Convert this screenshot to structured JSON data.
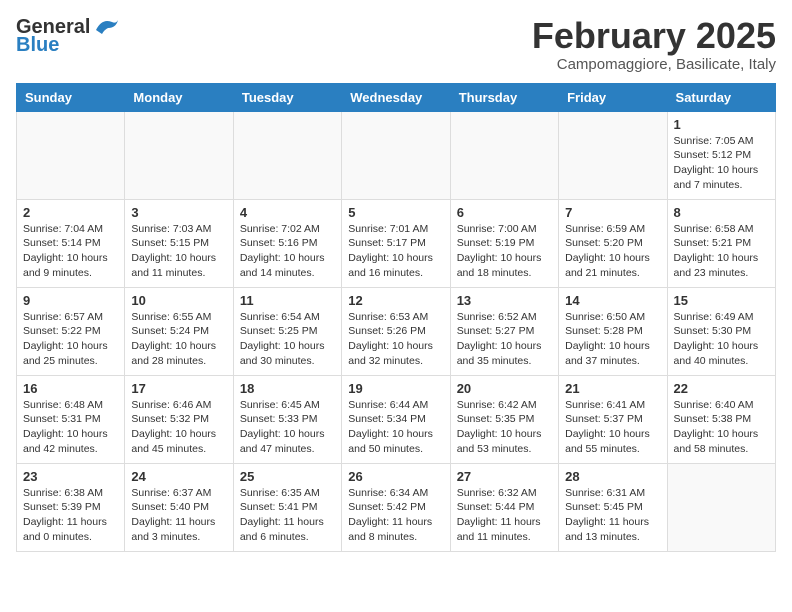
{
  "header": {
    "logo_general": "General",
    "logo_blue": "Blue",
    "title": "February 2025",
    "subtitle": "Campomaggiore, Basilicate, Italy"
  },
  "columns": [
    "Sunday",
    "Monday",
    "Tuesday",
    "Wednesday",
    "Thursday",
    "Friday",
    "Saturday"
  ],
  "weeks": [
    [
      {
        "day": "",
        "info": ""
      },
      {
        "day": "",
        "info": ""
      },
      {
        "day": "",
        "info": ""
      },
      {
        "day": "",
        "info": ""
      },
      {
        "day": "",
        "info": ""
      },
      {
        "day": "",
        "info": ""
      },
      {
        "day": "1",
        "info": "Sunrise: 7:05 AM\nSunset: 5:12 PM\nDaylight: 10 hours and 7 minutes."
      }
    ],
    [
      {
        "day": "2",
        "info": "Sunrise: 7:04 AM\nSunset: 5:14 PM\nDaylight: 10 hours and 9 minutes."
      },
      {
        "day": "3",
        "info": "Sunrise: 7:03 AM\nSunset: 5:15 PM\nDaylight: 10 hours and 11 minutes."
      },
      {
        "day": "4",
        "info": "Sunrise: 7:02 AM\nSunset: 5:16 PM\nDaylight: 10 hours and 14 minutes."
      },
      {
        "day": "5",
        "info": "Sunrise: 7:01 AM\nSunset: 5:17 PM\nDaylight: 10 hours and 16 minutes."
      },
      {
        "day": "6",
        "info": "Sunrise: 7:00 AM\nSunset: 5:19 PM\nDaylight: 10 hours and 18 minutes."
      },
      {
        "day": "7",
        "info": "Sunrise: 6:59 AM\nSunset: 5:20 PM\nDaylight: 10 hours and 21 minutes."
      },
      {
        "day": "8",
        "info": "Sunrise: 6:58 AM\nSunset: 5:21 PM\nDaylight: 10 hours and 23 minutes."
      }
    ],
    [
      {
        "day": "9",
        "info": "Sunrise: 6:57 AM\nSunset: 5:22 PM\nDaylight: 10 hours and 25 minutes."
      },
      {
        "day": "10",
        "info": "Sunrise: 6:55 AM\nSunset: 5:24 PM\nDaylight: 10 hours and 28 minutes."
      },
      {
        "day": "11",
        "info": "Sunrise: 6:54 AM\nSunset: 5:25 PM\nDaylight: 10 hours and 30 minutes."
      },
      {
        "day": "12",
        "info": "Sunrise: 6:53 AM\nSunset: 5:26 PM\nDaylight: 10 hours and 32 minutes."
      },
      {
        "day": "13",
        "info": "Sunrise: 6:52 AM\nSunset: 5:27 PM\nDaylight: 10 hours and 35 minutes."
      },
      {
        "day": "14",
        "info": "Sunrise: 6:50 AM\nSunset: 5:28 PM\nDaylight: 10 hours and 37 minutes."
      },
      {
        "day": "15",
        "info": "Sunrise: 6:49 AM\nSunset: 5:30 PM\nDaylight: 10 hours and 40 minutes."
      }
    ],
    [
      {
        "day": "16",
        "info": "Sunrise: 6:48 AM\nSunset: 5:31 PM\nDaylight: 10 hours and 42 minutes."
      },
      {
        "day": "17",
        "info": "Sunrise: 6:46 AM\nSunset: 5:32 PM\nDaylight: 10 hours and 45 minutes."
      },
      {
        "day": "18",
        "info": "Sunrise: 6:45 AM\nSunset: 5:33 PM\nDaylight: 10 hours and 47 minutes."
      },
      {
        "day": "19",
        "info": "Sunrise: 6:44 AM\nSunset: 5:34 PM\nDaylight: 10 hours and 50 minutes."
      },
      {
        "day": "20",
        "info": "Sunrise: 6:42 AM\nSunset: 5:35 PM\nDaylight: 10 hours and 53 minutes."
      },
      {
        "day": "21",
        "info": "Sunrise: 6:41 AM\nSunset: 5:37 PM\nDaylight: 10 hours and 55 minutes."
      },
      {
        "day": "22",
        "info": "Sunrise: 6:40 AM\nSunset: 5:38 PM\nDaylight: 10 hours and 58 minutes."
      }
    ],
    [
      {
        "day": "23",
        "info": "Sunrise: 6:38 AM\nSunset: 5:39 PM\nDaylight: 11 hours and 0 minutes."
      },
      {
        "day": "24",
        "info": "Sunrise: 6:37 AM\nSunset: 5:40 PM\nDaylight: 11 hours and 3 minutes."
      },
      {
        "day": "25",
        "info": "Sunrise: 6:35 AM\nSunset: 5:41 PM\nDaylight: 11 hours and 6 minutes."
      },
      {
        "day": "26",
        "info": "Sunrise: 6:34 AM\nSunset: 5:42 PM\nDaylight: 11 hours and 8 minutes."
      },
      {
        "day": "27",
        "info": "Sunrise: 6:32 AM\nSunset: 5:44 PM\nDaylight: 11 hours and 11 minutes."
      },
      {
        "day": "28",
        "info": "Sunrise: 6:31 AM\nSunset: 5:45 PM\nDaylight: 11 hours and 13 minutes."
      },
      {
        "day": "",
        "info": ""
      }
    ]
  ]
}
